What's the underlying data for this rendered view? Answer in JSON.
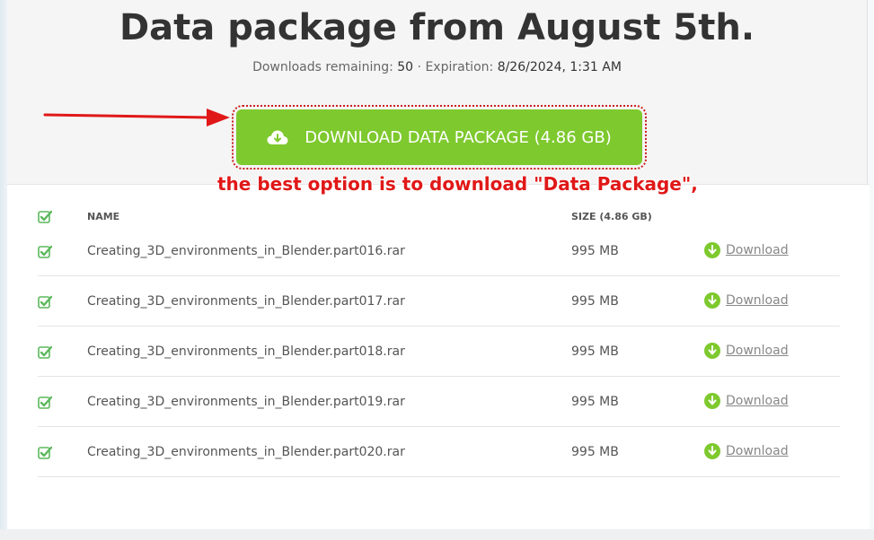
{
  "header": {
    "title": "Data package from August 5th.",
    "downloads_label": "Downloads remaining:",
    "downloads_value": "50",
    "separator": "·",
    "expiration_label": "Expiration:",
    "expiration_value": "8/26/2024, 1:31 AM"
  },
  "download_package": {
    "label": "DOWNLOAD DATA PACKAGE (4.86 GB)",
    "icon": "cloud-download-icon"
  },
  "annotation": {
    "text": "the best option is to download \"Data Package\","
  },
  "table": {
    "columns": {
      "name": "NAME",
      "size": "SIZE (4.86 GB)"
    },
    "rows": [
      {
        "name": "Creating_3D_environments_in_Blender.part016.rar",
        "size": "995 MB",
        "action": "Download"
      },
      {
        "name": "Creating_3D_environments_in_Blender.part017.rar",
        "size": "995 MB",
        "action": "Download"
      },
      {
        "name": "Creating_3D_environments_in_Blender.part018.rar",
        "size": "995 MB",
        "action": "Download"
      },
      {
        "name": "Creating_3D_environments_in_Blender.part019.rar",
        "size": "995 MB",
        "action": "Download"
      },
      {
        "name": "Creating_3D_environments_in_Blender.part020.rar",
        "size": "995 MB",
        "action": "Download"
      }
    ]
  },
  "colors": {
    "accent_green": "#7ec92e",
    "check_green": "#5cb85c",
    "annotation_red": "#e01818"
  }
}
